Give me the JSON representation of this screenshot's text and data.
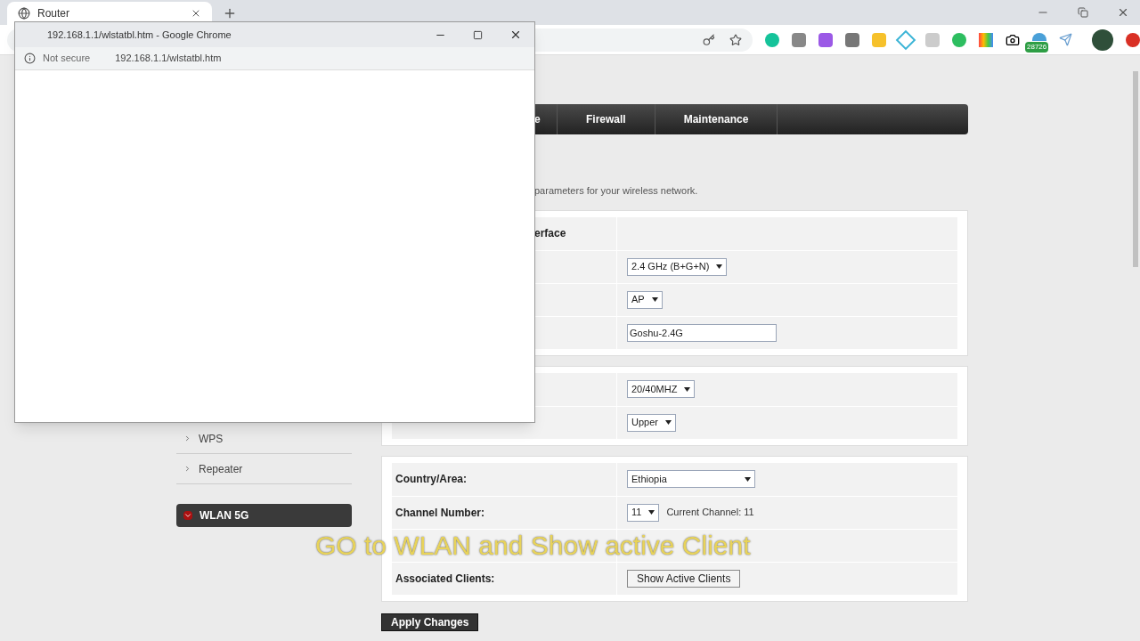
{
  "browser": {
    "tab_title": "Router",
    "extension_badge": "28726"
  },
  "popup": {
    "title": "192.168.1.1/wlstatbl.htm - Google Chrome",
    "security": "Not secure",
    "url": "192.168.1.1/wlstatbl.htm"
  },
  "nav": [
    {
      "label": "e"
    },
    {
      "label": "Firewall"
    },
    {
      "label": "Maintenance"
    }
  ],
  "description": "parameters for your wireless network.",
  "sidebar": {
    "items": [
      "WPS",
      "Repeater"
    ],
    "section": "WLAN 5G"
  },
  "panels": [
    {
      "rows": [
        {
          "kind": "header",
          "label": "erface"
        },
        {
          "kind": "select",
          "value": "2.4 GHz (B+G+N)"
        },
        {
          "kind": "select",
          "value": "AP"
        },
        {
          "kind": "input",
          "value": "Goshu-2.4G"
        }
      ]
    },
    {
      "rows": [
        {
          "kind": "select",
          "value": "20/40MHZ"
        },
        {
          "kind": "select",
          "value": "Upper"
        }
      ]
    },
    {
      "rows": [
        {
          "kind": "select",
          "label": "Country/Area:",
          "value": "Ethiopia"
        },
        {
          "kind": "select",
          "label": "Channel Number:",
          "value": "11",
          "note": "Current Channel: 11"
        },
        {
          "kind": "covered"
        },
        {
          "kind": "button",
          "label": "Associated Clients:",
          "value": "Show Active Clients"
        }
      ]
    }
  ],
  "apply_button": "Apply Changes",
  "caption": "GO to WLAN and Show active Client"
}
